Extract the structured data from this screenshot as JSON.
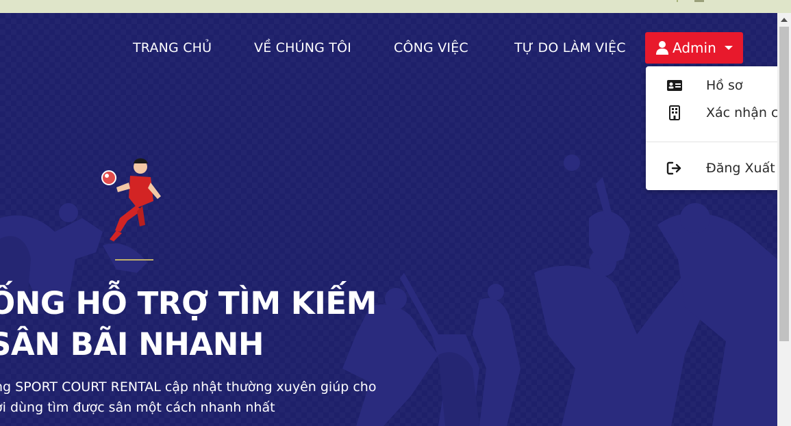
{
  "nav": {
    "links": [
      "TRANG CHỦ",
      "VỀ CHÚNG TÔI",
      "CÔNG VIỆC",
      "TỰ DO LÀM VIỆC"
    ],
    "admin_label": "Admin"
  },
  "dropdown": {
    "items": [
      {
        "label": "Hồ sơ",
        "icon": "id-card-icon"
      },
      {
        "label": "Xác nhận c",
        "icon": "building-icon"
      },
      {
        "label": "Đăng Xuất",
        "icon": "sign-out-icon"
      }
    ]
  },
  "hero": {
    "headline_line1": "ỐNG HỖ TRỢ TÌM KIẾM",
    "headline_line2": "SÂN BÃI NHANH",
    "subtitle_line1": "ng SPORT COURT RENTAL cập nhật thường xuyên giúp cho",
    "subtitle_line2": "ời dùng tìm được sân một cách nhanh nhất"
  },
  "colors": {
    "hero_bg": "#1e206a",
    "accent": "#e8192c",
    "silhouette": "#2b2c80"
  }
}
